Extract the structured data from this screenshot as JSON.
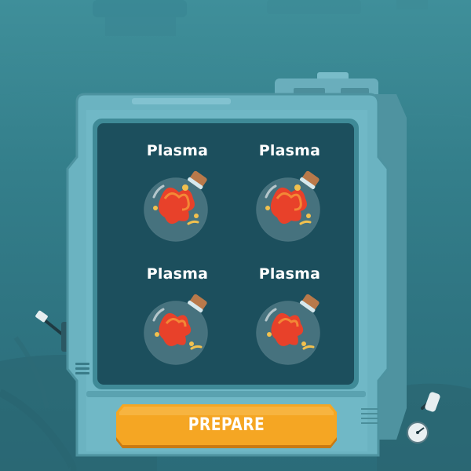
{
  "game": {
    "slots": [
      {
        "label": "Plasma",
        "item_icon": "plasma-potion-icon"
      },
      {
        "label": "Plasma",
        "item_icon": "plasma-potion-icon"
      },
      {
        "label": "Plasma",
        "item_icon": "plasma-potion-icon"
      },
      {
        "label": "Plasma",
        "item_icon": "plasma-potion-icon"
      }
    ],
    "prepare_button_label": "PREPARE"
  },
  "colors": {
    "background": "#347f8b",
    "machine_frame": "#6bb3c1",
    "screen": "#1c4f5d",
    "button": "#f5a623",
    "potion_liquid": "#e8412a",
    "cork": "#b9794a"
  }
}
